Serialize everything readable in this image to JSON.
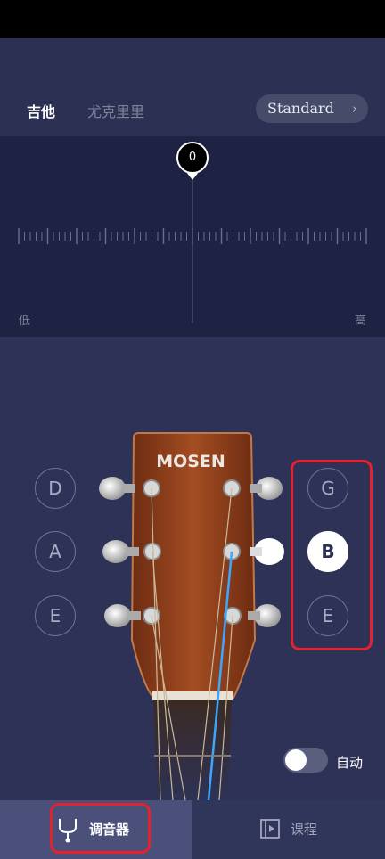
{
  "header": {
    "tabs": [
      {
        "label": "吉他",
        "active": true
      },
      {
        "label": "尤克里里",
        "active": false
      }
    ],
    "tuning": {
      "label": "Standard",
      "chevron_icon": "chevron-right-icon"
    }
  },
  "meter": {
    "value": "0",
    "low_label": "低",
    "high_label": "高"
  },
  "headstock": {
    "brand": "MOSEN"
  },
  "strings": {
    "left": [
      {
        "label": "D",
        "selected": false
      },
      {
        "label": "A",
        "selected": false
      },
      {
        "label": "E",
        "selected": false
      }
    ],
    "right": [
      {
        "label": "G",
        "selected": false
      },
      {
        "label": "B",
        "selected": true
      },
      {
        "label": "E",
        "selected": false
      }
    ]
  },
  "auto": {
    "label": "自动",
    "enabled": false
  },
  "nav": {
    "tuner_label": "调音器",
    "course_label": "课程"
  },
  "colors": {
    "background": "#2b3052",
    "meter_bg": "#1e2344",
    "active_nav": "#4a5079",
    "highlight": "#e3222e",
    "string_active": "#3aa8ff"
  }
}
